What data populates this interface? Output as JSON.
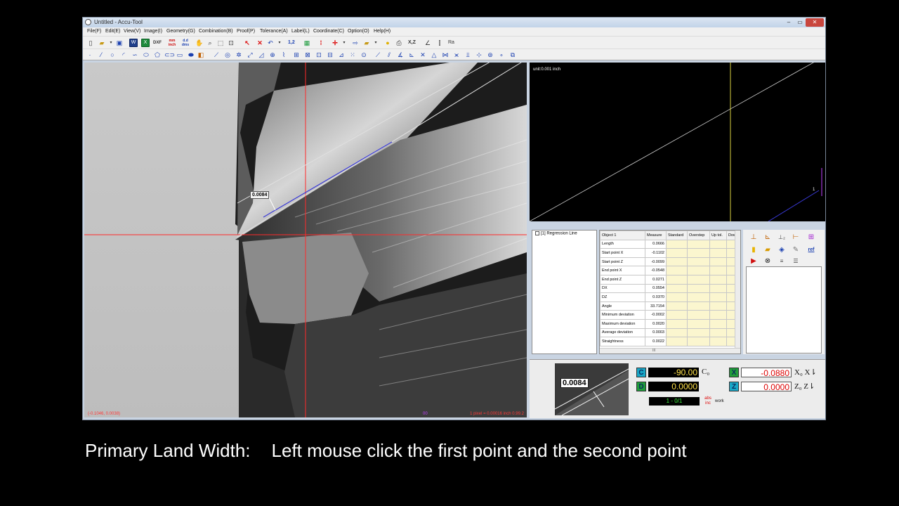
{
  "window": {
    "title": "Untitled - Accu-Tool",
    "min_glyph": "–",
    "max_glyph": "▭",
    "close_glyph": "✕"
  },
  "menu": [
    "File(F)",
    "Edit(E)",
    "View(V)",
    "Image(I)",
    "Geometry(G)",
    "Combination(B)",
    "Proof(P)",
    "Tolerance(A)",
    "Label(L)",
    "Coordinate(C)",
    "Option(O)",
    "Help(H)"
  ],
  "toolbar1": {
    "dxf_label": "DXF",
    "mm_inch_label": "mm inch",
    "d_dms_label": "d.d dms",
    "xz_label": "X,Z",
    "ra_label": "Ra",
    "onetwo_label": "1,2"
  },
  "camera": {
    "cursor_coords": "(-0.1046, 0.0038)",
    "page_num": "00",
    "pixel_scale": "1 pixel = 0.00016 inch   0.99.2",
    "measurement_label": "0.0084"
  },
  "graph": {
    "unit_label": "unit:0.001 inch",
    "marker_label": "1"
  },
  "tree": {
    "item_label": "[1] Regression Line"
  },
  "results": {
    "headers": [
      "Object 1",
      "Measure",
      "Standard",
      "Overstep",
      "Up tol.",
      "Dow"
    ],
    "rows": [
      {
        "name": "Length",
        "measure": "0.0666"
      },
      {
        "name": "Start point X",
        "measure": "-0.1102"
      },
      {
        "name": "Start point Z",
        "measure": "-0.0099"
      },
      {
        "name": "End point X",
        "measure": "-0.0548"
      },
      {
        "name": "End point Z",
        "measure": "0.0271"
      },
      {
        "name": "DX",
        "measure": "0.0554"
      },
      {
        "name": "DZ",
        "measure": "0.0370"
      },
      {
        "name": "Angle",
        "measure": "33.7154"
      },
      {
        "name": "Minimum deviation",
        "measure": "-0.0002"
      },
      {
        "name": "Maximum deviation",
        "measure": "0.0020"
      },
      {
        "name": "Average deviation",
        "measure": "0.0003"
      },
      {
        "name": "Straightness",
        "measure": "0.0022"
      }
    ],
    "hscroll_glyph": "III"
  },
  "actions": {
    "ref_label": "ref"
  },
  "readouts": {
    "thumb_label": "0.0084",
    "c_badge": "C",
    "c_value": "-90.00",
    "c_side": "C₀",
    "d_badge": "D",
    "d_value": "0.0000",
    "x_badge": "X",
    "x_value": "-0.0880",
    "x_side": "X₀ X⇂",
    "z_badge": "Z",
    "z_value": "0.0000",
    "z_side": "Z₀ Z⇂",
    "counter": "1 - 0/1",
    "work_icon": "abs inc",
    "work_label": "work"
  },
  "caption": {
    "title": "Primary Land Width:",
    "instruction": "Left mouse click the first point and the second point"
  },
  "colors": {
    "crosshair": "#ff2a2a",
    "graph_vertical": "#d8d040",
    "measure_line": "#3a3ad8"
  }
}
